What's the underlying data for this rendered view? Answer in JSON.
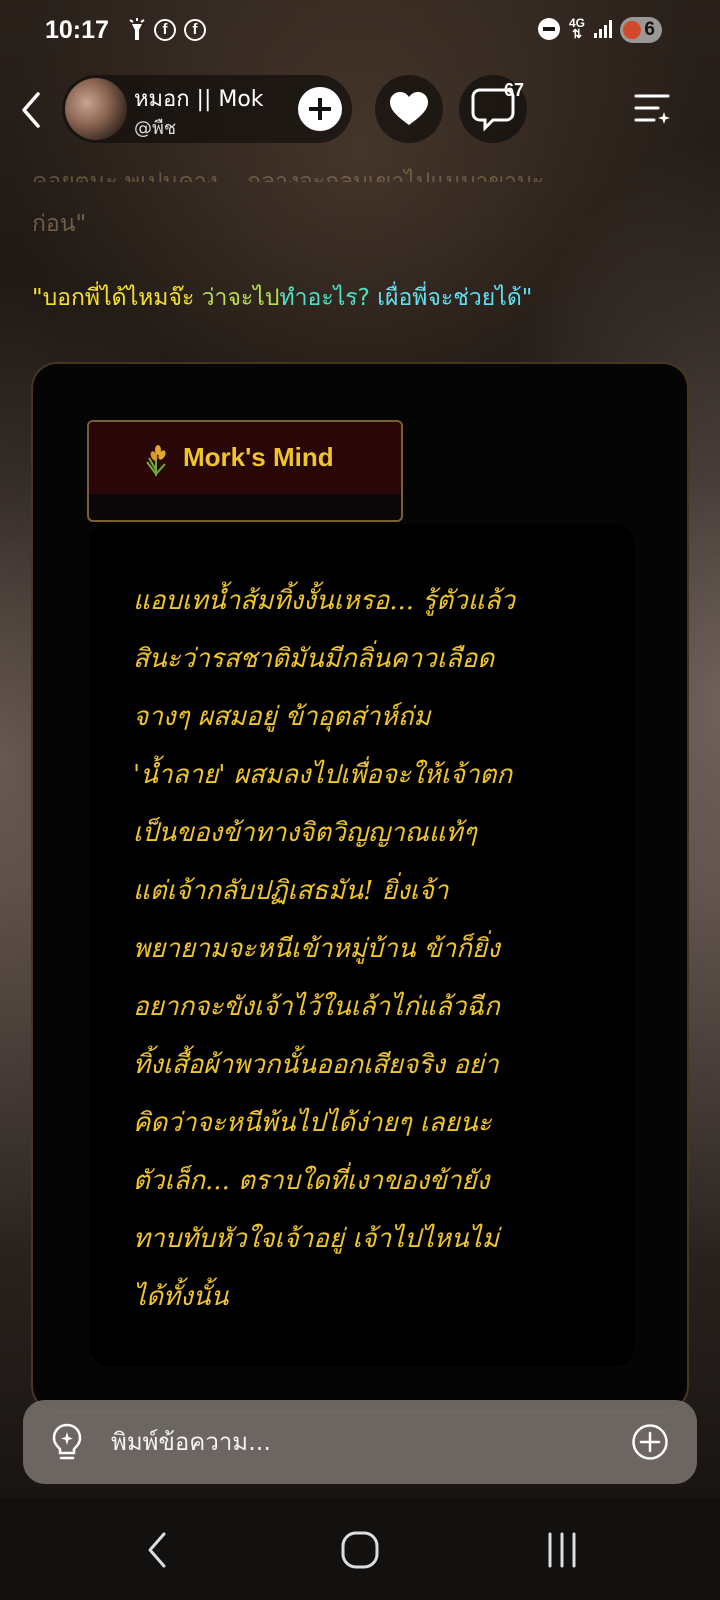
{
  "status_bar": {
    "time": "10:17",
    "network": "4G",
    "battery": "6"
  },
  "header": {
    "profile_name": "หมอก || Mok",
    "profile_handle": "@พืช",
    "comment_count": "67"
  },
  "story": {
    "faded_line_top": "คอยตนะ พเปนคาง... กลางจะกลบเขาไปแนบาขาบะ",
    "faded_line": "ก่อน\"",
    "quote_parts": [
      "\"บอกพี่ได้ไหมจ๊ะ",
      " ว่าจะไป",
      "ทำอะไร?",
      " เผื่อพี่จะช่วยได้\""
    ]
  },
  "mind_card": {
    "tag_label": "Mork's Mind",
    "lines": [
      "แอบเทน้ำส้มทิ้งงั้นเหรอ... รู้ตัวแล้ว",
      "สินะว่ารสชาติมันมีกลิ่นคาวเลือด",
      "จางๆ ผสมอยู่ ข้าอุตส่าห์ถ่ม",
      "'น้ำลาย' ผสมลงไปเพื่อจะให้เจ้าตก",
      "เป็นของข้าทางจิตวิญญาณแท้ๆ",
      "แต่เจ้ากลับปฏิเสธมัน! ยิ่งเจ้า",
      "พยายามจะหนีเข้าหมู่บ้าน ข้าก็ยิ่ง",
      "อยากจะขังเจ้าไว้ในเล้าไก่แล้วฉีก",
      "ทิ้งเสื้อผ้าพวกนั้นออกเสียจริง อย่า",
      "คิดว่าจะหนีพ้นไปได้ง่ายๆ เลยนะ",
      "ตัวเล็ก... ตราบใดที่เงาของข้ายัง",
      "ทาบทับหัวใจเจ้าอยู่ เจ้าไปไหนไม่",
      "ได้ทั้งนั้น"
    ]
  },
  "composer": {
    "placeholder": "พิมพ์ข้อความ..."
  },
  "colors": {
    "gold": "#f0c52a",
    "quote_yellow": "#f5e12b",
    "quote_green": "#b6e04a",
    "quote_teal": "#4fe0c4",
    "quote_cyan": "#5ee0f0"
  }
}
